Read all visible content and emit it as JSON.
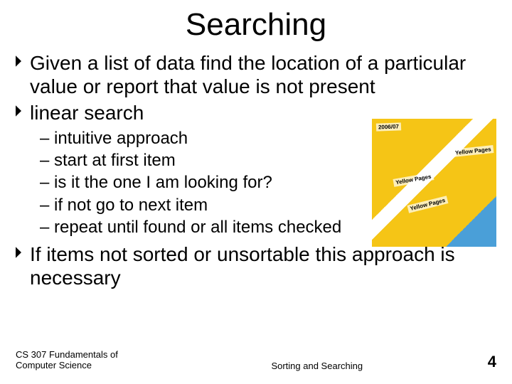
{
  "title": "Searching",
  "bullets": {
    "b1": "Given a list of data find the location of a particular value or report that value is not present",
    "b2": "linear search",
    "b3": "If items not sorted or unsortable this approach is necessary"
  },
  "subs": {
    "s1": "– intuitive approach",
    "s2": "– start at first item",
    "s3": "– is it the one I am looking for?",
    "s4": "– if not go to next item",
    "s5": "– repeat until found or all items checked"
  },
  "image": {
    "labels": {
      "l1": "2006/07",
      "l2": "Yellow Pages",
      "l3": "Yellow Pages",
      "l4": "Yellow Pages"
    }
  },
  "footer": {
    "left_line1": "CS 307 Fundamentals of",
    "left_line2": "Computer Science",
    "center": "Sorting and Searching",
    "page": "4"
  }
}
